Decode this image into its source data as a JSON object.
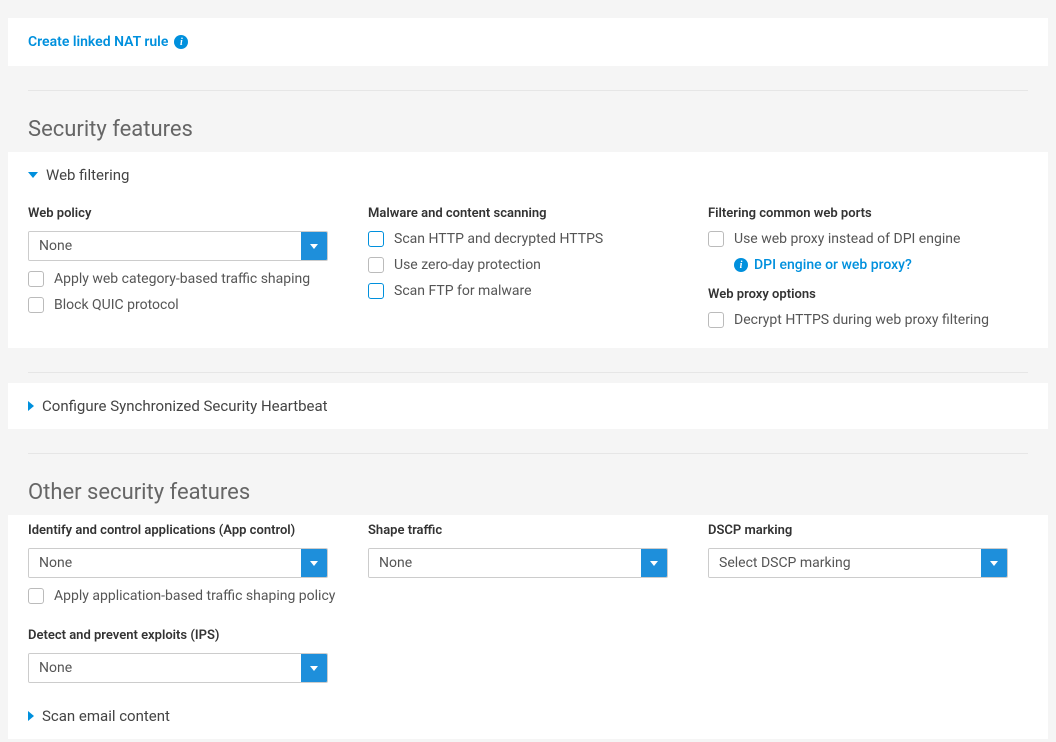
{
  "nat": {
    "create_link": "Create linked NAT rule"
  },
  "security": {
    "title": "Security features",
    "web_filtering": {
      "header": "Web filtering",
      "web_policy_label": "Web policy",
      "web_policy_value": "None",
      "apply_shaping": "Apply web category-based traffic shaping",
      "block_quic": "Block QUIC protocol",
      "malware_label": "Malware and content scanning",
      "scan_http": "Scan HTTP and decrypted HTTPS",
      "zero_day": "Use zero-day protection",
      "scan_ftp": "Scan FTP for malware",
      "filter_ports_label": "Filtering common web ports",
      "use_web_proxy": "Use web proxy instead of DPI engine",
      "help_link": "DPI engine or web proxy?",
      "web_proxy_options_label": "Web proxy options",
      "decrypt_https": "Decrypt HTTPS during web proxy filtering"
    },
    "heartbeat_header": "Configure Synchronized Security Heartbeat"
  },
  "other": {
    "title": "Other security features",
    "app_control_label": "Identify and control applications (App control)",
    "app_control_value": "None",
    "apply_app_shaping": "Apply application-based traffic shaping policy",
    "ips_label": "Detect and prevent exploits (IPS)",
    "ips_value": "None",
    "shape_traffic_label": "Shape traffic",
    "shape_traffic_value": "None",
    "dscp_label": "DSCP marking",
    "dscp_value": "Select DSCP marking",
    "scan_email_header": "Scan email content"
  }
}
